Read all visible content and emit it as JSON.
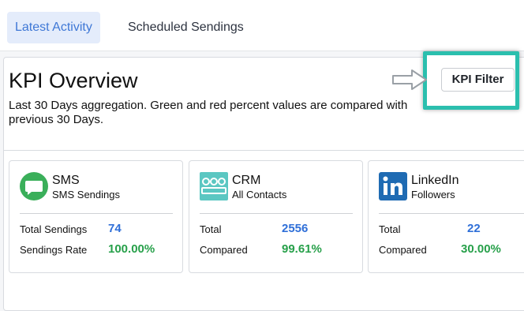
{
  "tabs": [
    {
      "label": "Latest Activity",
      "active": true
    },
    {
      "label": "Scheduled Sendings",
      "active": false
    }
  ],
  "panel": {
    "title": "KPI Overview",
    "description": "Last 30 Days aggregation. Green and red percent values are compared with previous 30 Days.",
    "filter_button": "KPI Filter"
  },
  "cards": [
    {
      "icon": "sms-chat-icon",
      "title": "SMS",
      "subtitle": "SMS Sendings",
      "row1_label": "Total Sendings",
      "row1_value": "74",
      "row2_label": "Sendings Rate",
      "row2_value": "100.00%"
    },
    {
      "icon": "crm-contacts-icon",
      "title": "CRM",
      "subtitle": "All Contacts",
      "row1_label": "Total",
      "row1_value": "2556",
      "row2_label": "Compared",
      "row2_value": "99.61%"
    },
    {
      "icon": "linkedin-icon",
      "title": "LinkedIn",
      "subtitle": "Followers",
      "row1_label": "Total",
      "row1_value": "22",
      "row2_label": "Compared",
      "row2_value": "30.00%"
    }
  ],
  "colors": {
    "blue_value": "#2f6fd8",
    "green_value": "#27a04a",
    "highlight": "#2bbfae",
    "active_tab_bg": "#e4ecfb"
  }
}
